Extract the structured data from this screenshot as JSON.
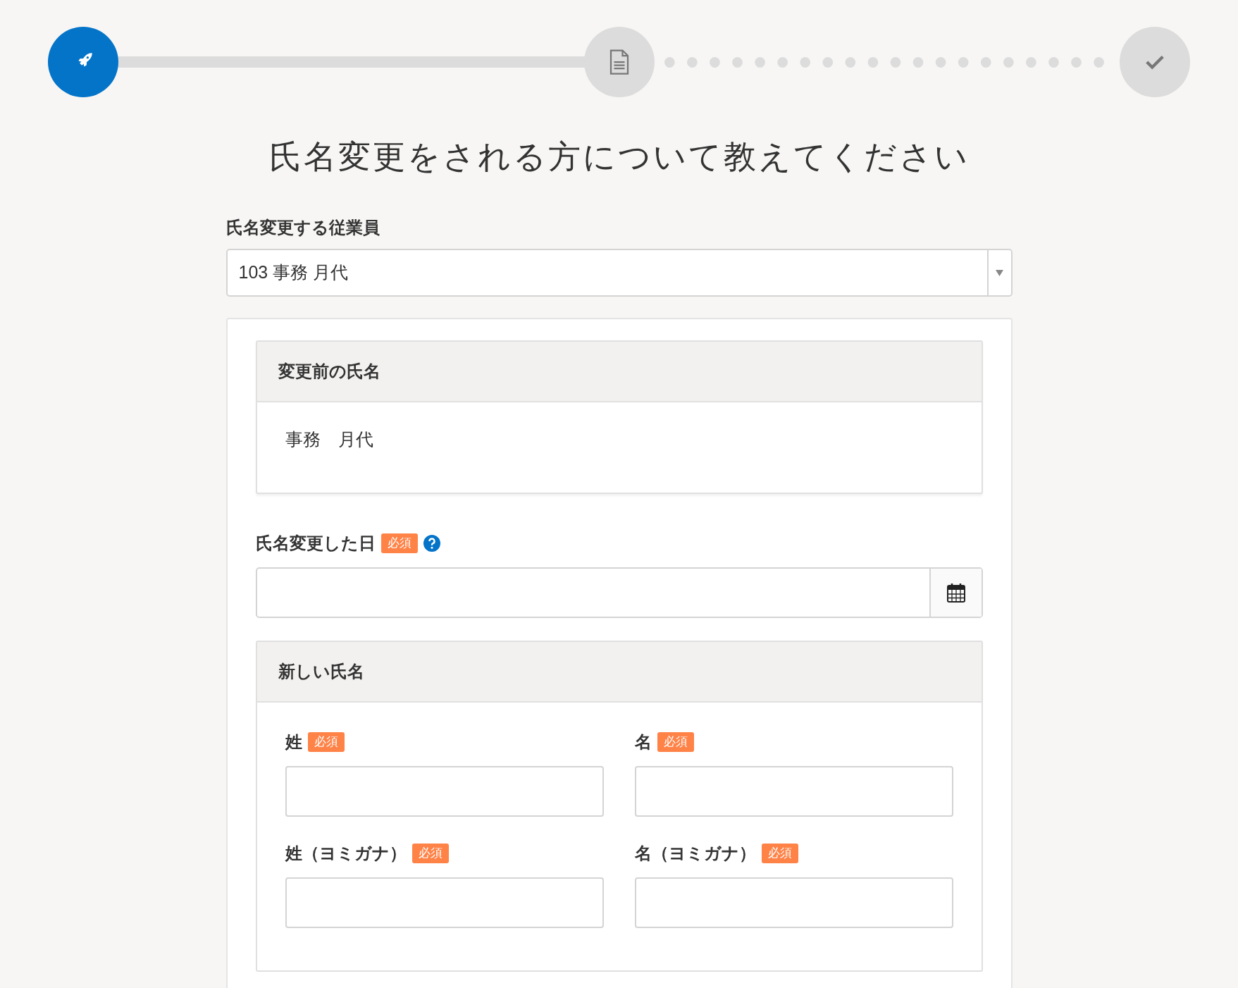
{
  "steps": [
    {
      "active": true
    },
    {
      "active": false
    },
    {
      "active": false
    }
  ],
  "connectors": [
    {
      "completed": true
    },
    {
      "completed": false
    }
  ],
  "title": "氏名変更をされる方について教えてください",
  "employee_field": {
    "label": "氏名変更する従業員",
    "value": "103 事務 月代"
  },
  "previous_name": {
    "heading": "変更前の氏名",
    "value": "事務　月代"
  },
  "change_date": {
    "label": "氏名変更した日",
    "badge": "必須"
  },
  "new_name": {
    "heading": "新しい氏名",
    "fields": [
      {
        "label": "姓",
        "badge": "必須"
      },
      {
        "label": "名",
        "badge": "必須"
      },
      {
        "label": "姓（ヨミガナ）",
        "badge": "必須"
      },
      {
        "label": "名（ヨミガナ）",
        "badge": "必須"
      }
    ]
  }
}
